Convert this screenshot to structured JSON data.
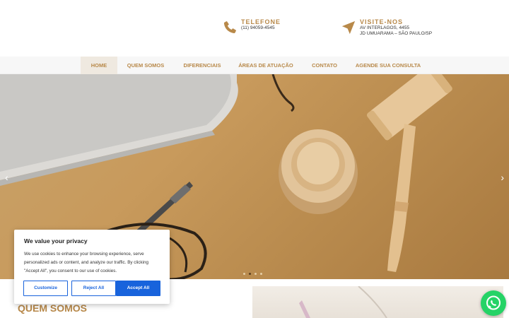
{
  "header": {
    "phone": {
      "title": "TELEFONE",
      "number": "(11) 94059-4545"
    },
    "visit": {
      "title": "VISITE-NOS",
      "line1": "AV INTERLAGOS, 4455",
      "line2": "JD UMUARAMA – SÃO PAULO/SP"
    }
  },
  "nav": {
    "items": [
      {
        "label": "HOME",
        "active": true
      },
      {
        "label": "QUEM SOMOS"
      },
      {
        "label": "DIFERENCIAIS"
      },
      {
        "label": "ÁREAS DE ATUAÇÃO"
      },
      {
        "label": "CONTATO"
      },
      {
        "label": "AGENDE SUA CONSULTA"
      }
    ]
  },
  "hero": {
    "prev_symbol": "‹",
    "next_symbol": "›",
    "slide_count": 4,
    "active_slide": 2
  },
  "about": {
    "title": "QUEM SOMOS"
  },
  "cookie": {
    "title": "We value your privacy",
    "text": "We use cookies to enhance your browsing experience, serve personalized ads or content, and analyze our traffic. By clicking \"Accept All\", you consent to our use of cookies.",
    "customize": "Customize",
    "reject": "Reject All",
    "accept": "Accept All"
  },
  "colors": {
    "brand": "#b8894a",
    "cookie_button": "#1863dc",
    "whatsapp": "#25d366"
  },
  "icons": {
    "phone": "phone-icon",
    "visit": "location-arrow-icon",
    "whatsapp": "whatsapp-icon"
  }
}
